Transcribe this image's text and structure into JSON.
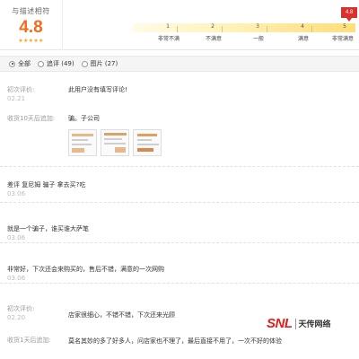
{
  "rating": {
    "title": "与描述相符",
    "score": "4.8",
    "stars": "★★★★★",
    "marker": "4.8",
    "scale": [
      {
        "num": "1",
        "label": "非常不满"
      },
      {
        "num": "2",
        "label": "不满意"
      },
      {
        "num": "3",
        "label": "一般"
      },
      {
        "num": "4",
        "label": "满意"
      },
      {
        "num": "5",
        "label": "非常满意"
      }
    ]
  },
  "filters": [
    {
      "label": "全部",
      "checked": true
    },
    {
      "label": "追评 (49)",
      "checked": false
    },
    {
      "label": "图片 (27)",
      "checked": false
    }
  ],
  "reviews": [
    {
      "tag": "初次评价:",
      "date": "02.21",
      "text": "此用户没有填写评论!",
      "followup_tag": "收货10天后追加:",
      "followup_text": "骗。子公司"
    },
    {
      "text": "差评 复尼姆 骗子 拿去买?吃",
      "date": "03.06"
    },
    {
      "text": "就是一个骗子，谁买谁大萨笔",
      "date": "03.06"
    },
    {
      "text": "非常好，下次还会来购买的，售后不错，满意的一次网购",
      "date": "03.06"
    },
    {
      "tag": "初次评价:",
      "date": "02.20",
      "text": "店家很细心，不错不错，下次还来光顾",
      "followup_tag": "收货1天后追加:",
      "followup_text": "莫名其妙的多了好多人，问店家也不理了，最后直接不用了，一次不好的体验"
    }
  ],
  "watermark": {
    "brand": "SNL",
    "cn": "天传网络"
  }
}
